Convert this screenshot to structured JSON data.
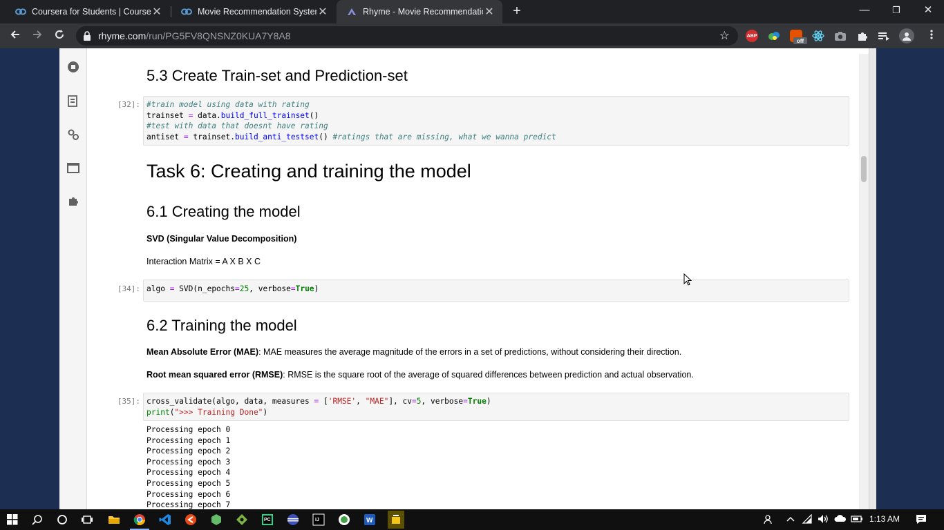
{
  "browser": {
    "tabs": [
      {
        "title": "Coursera for Students | Coursera",
        "active": false
      },
      {
        "title": "Movie Recommendation System",
        "active": false
      },
      {
        "title": "Rhyme - Movie Recommendation",
        "active": true
      }
    ],
    "new_tab": "+",
    "url_host": "rhyme.com",
    "url_path": "/run/PG5FV8QNSNZ0KUA7Y8A8",
    "ext_abp": "ABP",
    "ext_off": "off",
    "window_controls": {
      "minimize": "—",
      "restore": "❐",
      "close": "✕"
    }
  },
  "notebook": {
    "heading_53": "5.3 Create Train-set and Prediction-set",
    "cell32": {
      "prompt": "[32]:",
      "line1_comment": "#train model using data with rating",
      "line2_var": "trainset ",
      "line2_op": "=",
      "line2_obj": " data.",
      "line2_fn": "build_full_trainset",
      "line2_end": "()",
      "line3_comment": "#test with data that doesnt have rating",
      "line4_var": "antiset ",
      "line4_op": "=",
      "line4_obj": " trainset.",
      "line4_fn": "build_anti_testset",
      "line4_end": "() ",
      "line4_comment": "#ratings that are missing, what we wanna predict"
    },
    "heading_task6": "Task 6: Creating and training the model",
    "heading_61": "6.1 Creating the model",
    "svd_bold": "SVD (Singular Value Decomposition)",
    "interaction_text": "Interaction Matrix = A X B X C",
    "cell34": {
      "prompt": "[34]:",
      "a": "algo ",
      "op": "=",
      "b": " SVD(n_epochs",
      "op2": "=",
      "num": "25",
      "c": ", verbose",
      "op3": "=",
      "kw": "True",
      "d": ")"
    },
    "heading_62": "6.2 Training the model",
    "mae_bold": "Mean Absolute Error (MAE)",
    "mae_text": ": MAE measures the average magnitude of the errors in a set of predictions, without considering their direction.",
    "rmse_bold": "Root mean squared error (RMSE)",
    "rmse_text": ": RMSE is the square root of the average of squared differences between prediction and actual observation.",
    "cell35": {
      "prompt": "[35]:",
      "a": "cross_validate(algo, data, measures ",
      "op": "=",
      "b": " [",
      "s1": "'RMSE'",
      "c": ", ",
      "s2": "\"MAE\"",
      "d": "], cv",
      "op2": "=",
      "num": "5",
      "e": ", verbose",
      "op3": "=",
      "kw": "True",
      "f": ")",
      "p_fn": "print",
      "p_open": "(",
      "p_str": "\">>> Training Done\"",
      "p_close": ")"
    },
    "output_lines": [
      "Processing epoch 0",
      "Processing epoch 1",
      "Processing epoch 2",
      "Processing epoch 3",
      "Processing epoch 4",
      "Processing epoch 5",
      "Processing epoch 6",
      "Processing epoch 7"
    ]
  },
  "taskbar": {
    "time": "1:13 AM"
  }
}
